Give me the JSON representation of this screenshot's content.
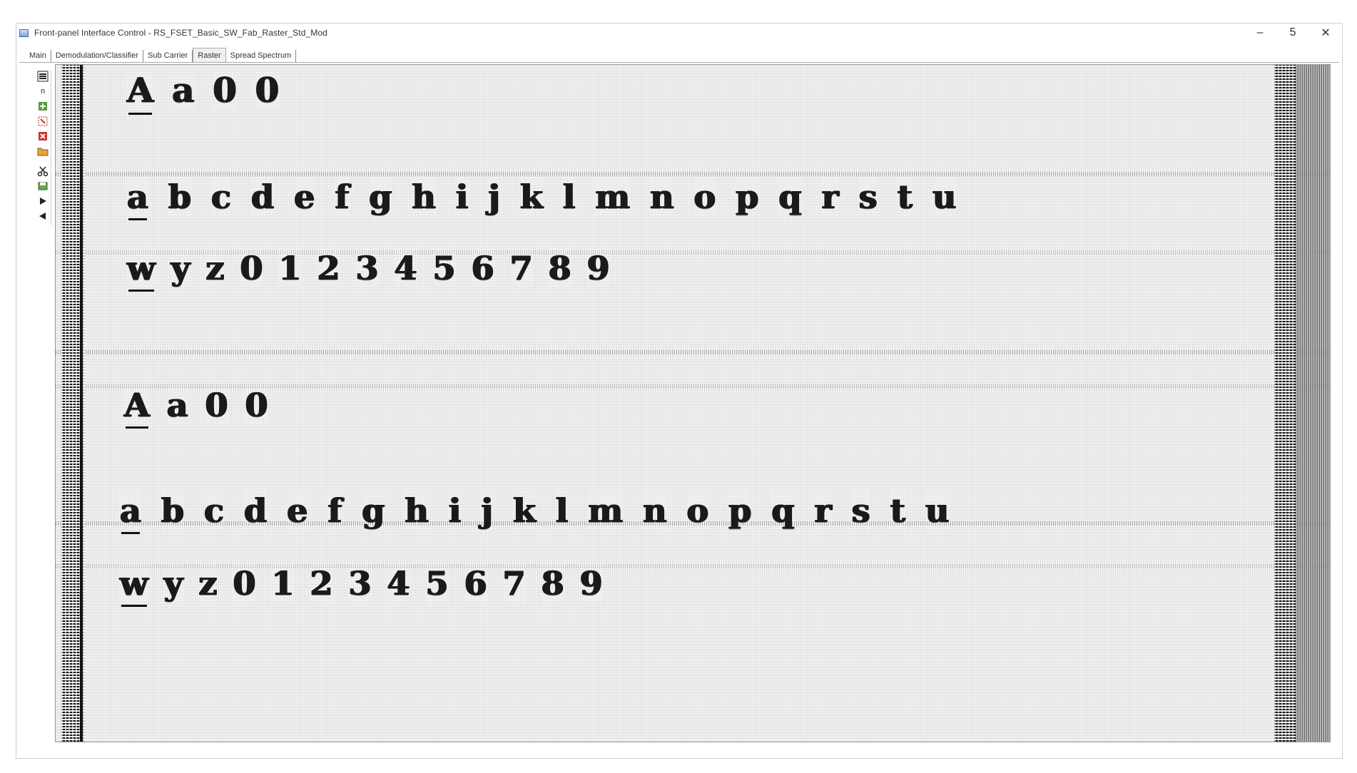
{
  "window": {
    "title": "Front-panel Interface Control - RS_FSET_Basic_SW_Fab_Raster_Std_Mod",
    "controls": {
      "minimize": "–",
      "maximize": "5",
      "close": "✕"
    }
  },
  "tabs": [
    {
      "label": "Main",
      "active": false
    },
    {
      "label": "Demodulation/Classifier",
      "active": false
    },
    {
      "label": "Sub Carrier",
      "active": false
    },
    {
      "label": "Raster",
      "active": true
    },
    {
      "label": "Spread Spectrum",
      "active": false
    }
  ],
  "toolbar": {
    "icons": [
      "menu-icon",
      "zoom-icon",
      "add-marker-icon",
      "select-area-icon",
      "delete-icon",
      "open-folder-icon",
      "cut-icon",
      "save-icon",
      "play-forward-icon",
      "play-back-icon"
    ],
    "zoom_label": "n"
  },
  "raster": {
    "rows": [
      {
        "text": "Aa00"
      },
      {
        "text": "abcdefghijklmnopqrstu"
      },
      {
        "text": "wyz0123456789"
      },
      {
        "text": "Aa00"
      },
      {
        "text": "abcdefghijklmnopqrstu"
      },
      {
        "text": "wyz0123456789"
      }
    ]
  },
  "colors": {
    "ink": "#1a1a1a",
    "background": "#f1f1f1",
    "frame": "#cfcfcf"
  }
}
